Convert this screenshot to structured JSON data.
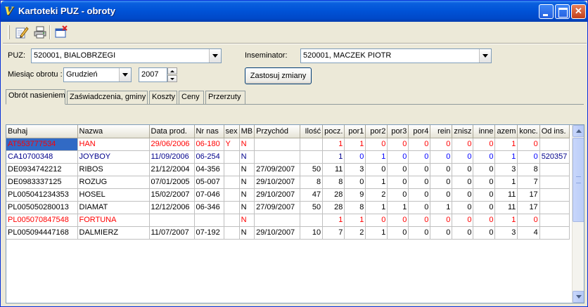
{
  "window": {
    "title": "Kartoteki PUZ - obroty"
  },
  "toolbar": {
    "icons": [
      "edit-icon",
      "print-icon",
      "close-window-icon"
    ]
  },
  "filters": {
    "puz_label": "PUZ:",
    "puz_value": "520001, BIALOBRZEGI",
    "inseminator_label": "Inseminator:",
    "inseminator_value": "520001, MACZEK PIOTR",
    "month_label": "Miesiąc obrotu :",
    "month_value": "Grudzień",
    "year_value": "2007",
    "apply_label": "Zastosuj zmiany"
  },
  "tabs": [
    {
      "label": "Obrót nasieniem",
      "active": true
    },
    {
      "label": "Zaświadczenia, gminy",
      "active": false
    },
    {
      "label": "Koszty",
      "active": false
    },
    {
      "label": "Ceny",
      "active": false
    },
    {
      "label": "Przerzuty",
      "active": false
    }
  ],
  "grid": {
    "columns": [
      "Buhaj",
      "Nazwa",
      "Data prod.",
      "Nr nas",
      "sex",
      "MB",
      "Przychód",
      "Ilość",
      "pocz.",
      "por1",
      "por2",
      "por3",
      "por4",
      "rein",
      "znisz",
      "inne",
      "azem",
      "konc.",
      "Od ins."
    ],
    "colors": {
      "red": "#ff0000",
      "blue": "#0000ff",
      "navy": "#00008b",
      "black": "#000000"
    },
    "rows": [
      {
        "cells": [
          "AT553777534",
          "HAN",
          "29/06/2006",
          "06-180",
          "Y",
          "N",
          "",
          "",
          "1",
          "1",
          "0",
          "0",
          "0",
          "0",
          "0",
          "0",
          "1",
          "0",
          ""
        ],
        "color": "red",
        "selected": true
      },
      {
        "cells": [
          "CA10700348",
          "JOYBOY",
          "11/09/2006",
          "06-254",
          "",
          "N",
          "",
          "",
          "1",
          "0",
          "1",
          "0",
          "0",
          "0",
          "0",
          "0",
          "1",
          "0",
          "520357"
        ],
        "color": "navy"
      },
      {
        "cells": [
          "DE0934742212",
          "RIBOS",
          "21/12/2004",
          "04-356",
          "",
          "N",
          "27/09/2007",
          "50",
          "11",
          "3",
          "0",
          "0",
          "0",
          "0",
          "0",
          "0",
          "3",
          "8",
          ""
        ],
        "color": "black"
      },
      {
        "cells": [
          "DE0983337125",
          "ROZUG",
          "07/01/2005",
          "05-007",
          "",
          "N",
          "29/10/2007",
          "8",
          "8",
          "0",
          "1",
          "0",
          "0",
          "0",
          "0",
          "0",
          "1",
          "7",
          ""
        ],
        "color": "black"
      },
      {
        "cells": [
          "PL005041234353",
          "HOSEL",
          "15/02/2007",
          "07-046",
          "",
          "N",
          "29/10/2007",
          "47",
          "28",
          "9",
          "2",
          "0",
          "0",
          "0",
          "0",
          "0",
          "11",
          "17",
          ""
        ],
        "color": "black"
      },
      {
        "cells": [
          "PL005050280013",
          "DIAMAT",
          "12/12/2006",
          "06-346",
          "",
          "N",
          "27/09/2007",
          "50",
          "28",
          "8",
          "1",
          "1",
          "0",
          "1",
          "0",
          "0",
          "11",
          "17",
          ""
        ],
        "color": "black"
      },
      {
        "cells": [
          "PL005070847548",
          "FORTUNA",
          "",
          "",
          "",
          "N",
          "",
          "",
          "1",
          "1",
          "0",
          "0",
          "0",
          "0",
          "0",
          "0",
          "1",
          "0",
          ""
        ],
        "color": "red"
      },
      {
        "cells": [
          "PL005094447168",
          "DALMIERZ",
          "11/07/2007",
          "07-192",
          "",
          "N",
          "29/10/2007",
          "10",
          "7",
          "2",
          "1",
          "0",
          "0",
          "0",
          "0",
          "0",
          "3",
          "4",
          ""
        ],
        "color": "black"
      }
    ]
  }
}
